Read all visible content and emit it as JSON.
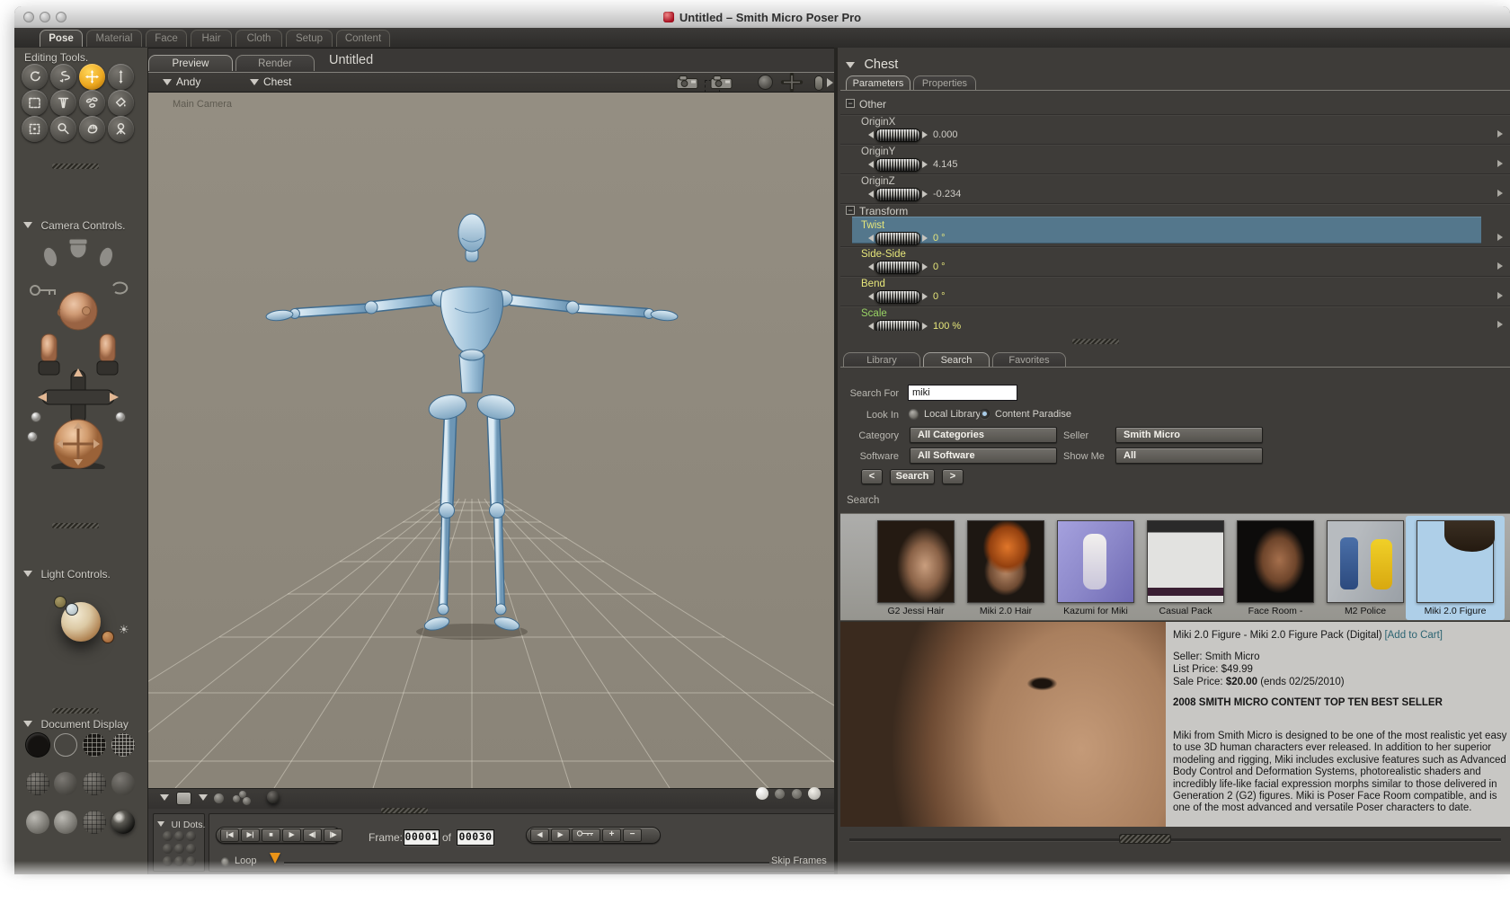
{
  "window": {
    "title": "Untitled – Smith Micro Poser Pro"
  },
  "main_tabs": {
    "pose": "Pose",
    "material": "Material",
    "face": "Face",
    "hair": "Hair",
    "cloth": "Cloth",
    "setup": "Setup",
    "content": "Content"
  },
  "editing_tools": {
    "title": "Editing Tools.",
    "tool_names": [
      "rotate",
      "twist",
      "translate-pull",
      "translate-in-out",
      "scale",
      "taper",
      "morphing-tool",
      "color",
      "grouping",
      "view-magnifier",
      "direct-manipulation",
      "camera-dolly"
    ],
    "active_tool": "translate-pull"
  },
  "camera_controls": {
    "title": "Camera Controls."
  },
  "light_controls": {
    "title": "Light Controls."
  },
  "document_display": {
    "title": "Document Display"
  },
  "viewport": {
    "tab_preview": "Preview",
    "tab_render": "Render",
    "document_name": "Untitled",
    "figure_selector": "Andy",
    "actor_selector": "Chest",
    "camera_label": "Main Camera"
  },
  "timeline": {
    "title": "UI Dots.",
    "frame_label": "Frame:",
    "frame_current": "00001",
    "of_label": "of",
    "frame_total": "00030",
    "loop_label": "Loop",
    "skip_frames_label": "Skip Frames"
  },
  "parameters": {
    "header": "Chest",
    "tab_parameters": "Parameters",
    "tab_properties": "Properties",
    "groups": [
      {
        "name": "Other",
        "rows": [
          {
            "label": "OriginX",
            "value": "0.000"
          },
          {
            "label": "OriginY",
            "value": "4.145"
          },
          {
            "label": "OriginZ",
            "value": "-0.234"
          }
        ]
      },
      {
        "name": "Transform",
        "rows": [
          {
            "label": "Twist",
            "value": "0 °",
            "selected": true
          },
          {
            "label": "Side-Side",
            "value": "0 °"
          },
          {
            "label": "Bend",
            "value": "0 °"
          },
          {
            "label": "Scale",
            "value": "100 %"
          }
        ]
      }
    ]
  },
  "library": {
    "tab_library": "Library",
    "tab_search": "Search",
    "tab_favorites": "Favorites",
    "search_for_label": "Search For",
    "search_value": "miki",
    "look_in_label": "Look In",
    "radio_local_label": "Local Library",
    "radio_paradise_label": "Content Paradise",
    "category_label": "Category",
    "category_value": "All Categories",
    "seller_label": "Seller",
    "seller_value": "Smith Micro",
    "software_label": "Software",
    "software_value": "All Software",
    "show_me_label": "Show Me",
    "show_me_value": "All",
    "prev_label": "<",
    "search_button_label": "Search",
    "next_label": ">",
    "results_header": "Search",
    "results": [
      {
        "label": "G2 Jessi Hair"
      },
      {
        "label": "Miki 2.0 Hair"
      },
      {
        "label": "Kazumi for Miki"
      },
      {
        "label": "Casual Pack"
      },
      {
        "label": "Face Room -"
      },
      {
        "label": "M2 Police"
      },
      {
        "label": "Miki 2.0 Figure"
      }
    ],
    "selected_result": "Miki 2.0 Figure"
  },
  "detail": {
    "title": "Miki 2.0 Figure - Miki 2.0 Figure Pack (Digital)",
    "add_to_cart": "[Add to Cart]",
    "seller": "Seller: Smith Micro",
    "list_price": "List Price: $49.99",
    "sale_price_label": "Sale Price:",
    "sale_price": "$20.00",
    "sale_price_note": "(ends 02/25/2010)",
    "banner": "2008 SMITH MICRO CONTENT TOP TEN BEST SELLER",
    "description": "Miki from Smith Micro is designed to be one of the most realistic yet easy to use 3D human characters ever released. In addition to her superior modeling and rigging, Miki includes exclusive features such as Advanced Body Control and Deformation Systems, photorealistic shaders and incredibly life-like facial expression morphs similar to those delivered in Generation 2 (G2) figures. Miki is Poser Face Room compatible, and is one of the most advanced and versatile Poser characters to date."
  },
  "colors": {
    "active_tool_orange": "#eda921",
    "selected_row_blue": "#567c94",
    "transform_label_yellow": "#e6e67a",
    "scale_label_green": "#98d264",
    "selected_thumb_blue": "#aecfe8",
    "viewport_taupe": "#8d8779"
  }
}
